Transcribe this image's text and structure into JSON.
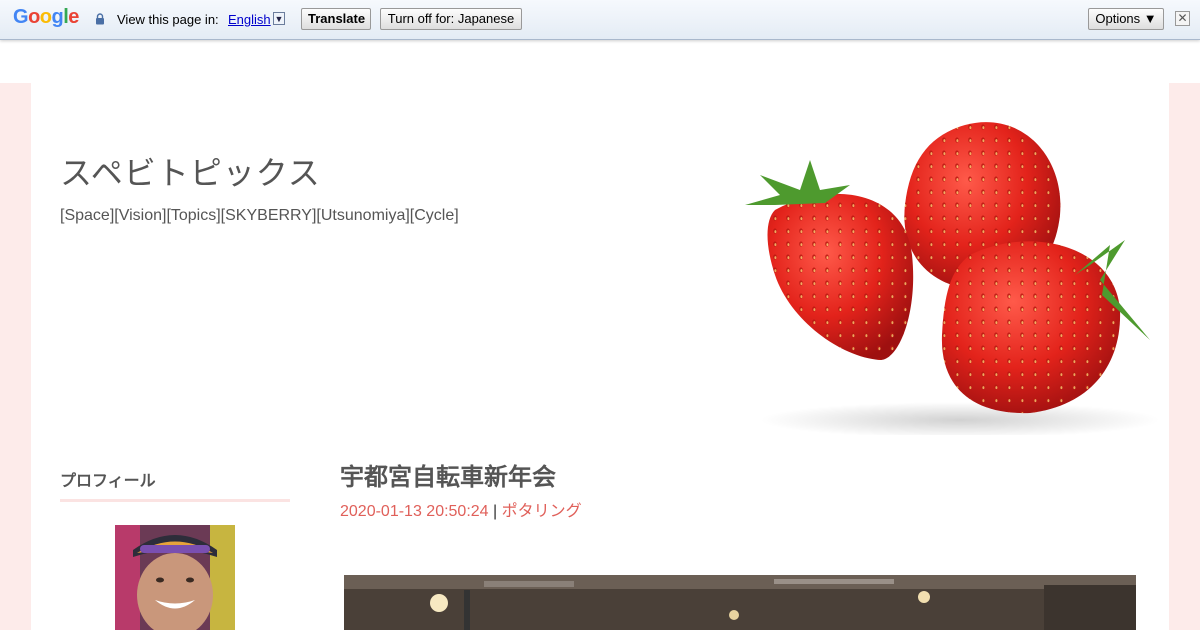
{
  "translate_bar": {
    "logo_letters": [
      {
        "ch": "G",
        "color": "#4285f4"
      },
      {
        "ch": "o",
        "color": "#ea4335"
      },
      {
        "ch": "o",
        "color": "#fbbc05"
      },
      {
        "ch": "g",
        "color": "#4285f4"
      },
      {
        "ch": "l",
        "color": "#34a853"
      },
      {
        "ch": "e",
        "color": "#ea4335"
      }
    ],
    "prompt": "View this page in:",
    "language": "English",
    "translate_label": "Translate",
    "turn_off_label": "Turn off for: Japanese",
    "options_label": "Options ▼",
    "close_glyph": "✕"
  },
  "site": {
    "title": "スペビトピックス",
    "description": "[Space][Vision][Topics][SKYBERRY][Utsunomiya][Cycle]",
    "accent_color": "#e0605a",
    "side_bg_color": "#fdebea"
  },
  "sidebar": {
    "profile_title": "プロフィール"
  },
  "post": {
    "title": "宇都宮自転車新年会",
    "date": "2020-01-13 20:50:24",
    "separator": " | ",
    "category": "ポタリング"
  }
}
